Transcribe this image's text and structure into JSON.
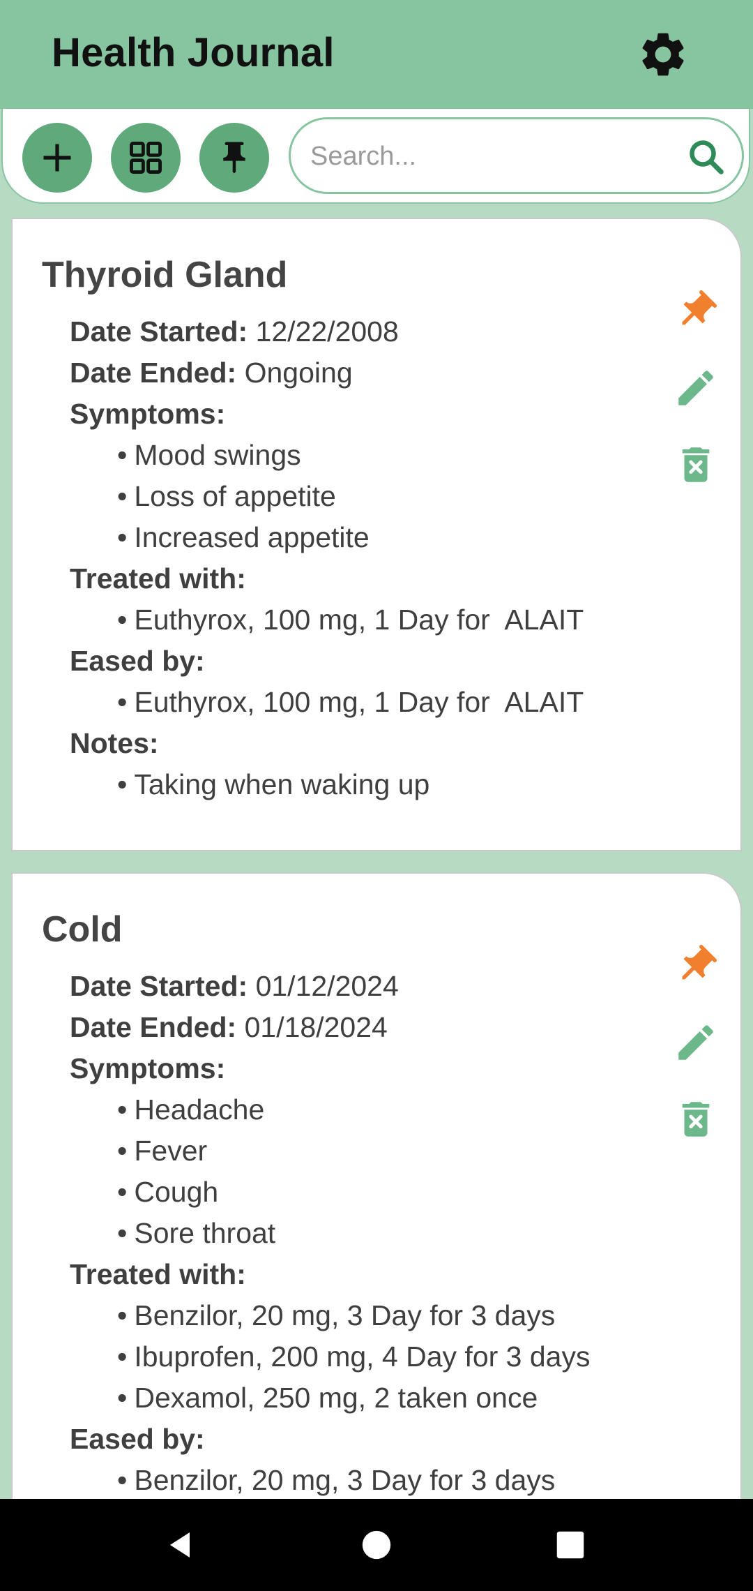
{
  "app": {
    "title": "Health Journal"
  },
  "toolbar": {
    "add_icon": "plus-icon",
    "grid_icon": "grid-view-icon",
    "pin_icon": "pin-icon",
    "search_placeholder": "Search..."
  },
  "colors": {
    "appbar": "#87c5a1",
    "background": "#b6dac2",
    "accent_green": "#5fa97a",
    "pin_orange": "#f0802e"
  },
  "labels": {
    "date_started": "Date Started:",
    "date_ended": "Date Ended:",
    "symptoms": "Symptoms:",
    "treated_with": "Treated with:",
    "eased_by": "Eased by:",
    "notes": "Notes:"
  },
  "entries": [
    {
      "title": "Thyroid Gland",
      "date_started": "12/22/2008",
      "date_ended": "Ongoing",
      "symptoms": [
        "Mood swings",
        "Loss of appetite",
        "Increased appetite"
      ],
      "treated_with": [
        "Euthyrox, 100 mg, 1 Day for  ALAIT"
      ],
      "eased_by": [
        "Euthyrox, 100 mg, 1 Day for  ALAIT"
      ],
      "notes": [
        "Taking when waking up"
      ]
    },
    {
      "title": "Cold",
      "date_started": "01/12/2024",
      "date_ended": "01/18/2024",
      "symptoms": [
        "Headache",
        "Fever",
        "Cough",
        "Sore throat"
      ],
      "treated_with": [
        "Benzilor, 20 mg, 3 Day for 3 days",
        "Ibuprofen, 200 mg, 4 Day for 3 days",
        "Dexamol, 250 mg, 2 taken once"
      ],
      "eased_by": [
        "Benzilor, 20 mg, 3 Day for 3 days"
      ]
    }
  ],
  "navbar": {
    "back_icon": "back-triangle-icon",
    "home_icon": "home-circle-icon",
    "recents_icon": "recents-square-icon"
  }
}
